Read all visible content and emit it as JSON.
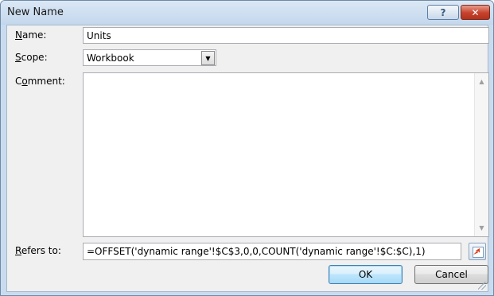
{
  "window": {
    "title": "New Name",
    "help_label": "?",
    "close_label": "✕"
  },
  "form": {
    "name": {
      "label_accel": "N",
      "label_rest": "ame:",
      "value": "Units"
    },
    "scope": {
      "label_accel": "S",
      "label_rest": "cope:",
      "value": "Workbook"
    },
    "comment": {
      "label_pre": "C",
      "label_accel": "o",
      "label_rest": "mment:",
      "value": ""
    },
    "refers_to": {
      "label_accel": "R",
      "label_rest": "efers to:",
      "value": "=OFFSET('dynamic range'!$C$3,0,0,COUNT('dynamic range'!$C:$C),1)"
    }
  },
  "buttons": {
    "ok": "OK",
    "cancel": "Cancel"
  },
  "icons": {
    "dropdown": "chevron-down-icon",
    "scroll_up": "scroll-up-icon",
    "scroll_down": "scroll-down-icon",
    "collapse": "collapse-dialog-icon"
  },
  "colors": {
    "titlebar": "#c9dcef",
    "close": "#c5412b",
    "client": "#f0f0f0",
    "default_button_border": "#3c7fb1"
  }
}
